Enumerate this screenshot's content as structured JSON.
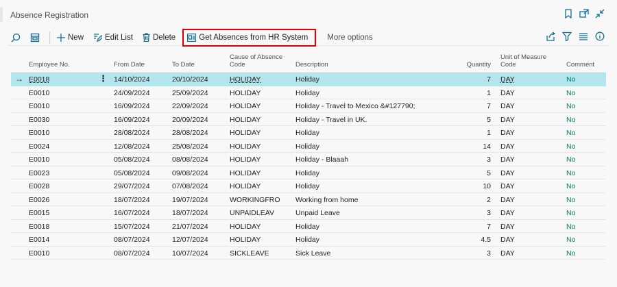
{
  "page": {
    "title": "Absence Registration"
  },
  "actions": {
    "new_label": "New",
    "edit_list_label": "Edit List",
    "delete_label": "Delete",
    "get_absences_label": "Get Absences from HR System",
    "more_options_label": "More options"
  },
  "columns": {
    "employee_no": "Employee No.",
    "from_date": "From Date",
    "to_date": "To Date",
    "cause_line1": "Cause of Absence",
    "cause_line2": "Code",
    "description": "Description",
    "quantity": "Quantity",
    "uom_line1": "Unit of Measure",
    "uom_line2": "Code",
    "comment": "Comment"
  },
  "rows": [
    {
      "emp": "E0018",
      "from": "14/10/2024",
      "to": "20/10/2024",
      "cause": "HOLIDAY",
      "desc": "Holiday",
      "qty": "7",
      "uom": "DAY",
      "comment": "No"
    },
    {
      "emp": "E0010",
      "from": "24/09/2024",
      "to": "25/09/2024",
      "cause": "HOLIDAY",
      "desc": "Holiday",
      "qty": "1",
      "uom": "DAY",
      "comment": "No"
    },
    {
      "emp": "E0010",
      "from": "16/09/2024",
      "to": "22/09/2024",
      "cause": "HOLIDAY",
      "desc": "Holiday - Travel to Mexico &#127790;",
      "qty": "7",
      "uom": "DAY",
      "comment": "No"
    },
    {
      "emp": "E0030",
      "from": "16/09/2024",
      "to": "20/09/2024",
      "cause": "HOLIDAY",
      "desc": "Holiday - Travel in UK.",
      "qty": "5",
      "uom": "DAY",
      "comment": "No"
    },
    {
      "emp": "E0010",
      "from": "28/08/2024",
      "to": "28/08/2024",
      "cause": "HOLIDAY",
      "desc": "Holiday",
      "qty": "1",
      "uom": "DAY",
      "comment": "No"
    },
    {
      "emp": "E0024",
      "from": "12/08/2024",
      "to": "25/08/2024",
      "cause": "HOLIDAY",
      "desc": "Holiday",
      "qty": "14",
      "uom": "DAY",
      "comment": "No"
    },
    {
      "emp": "E0010",
      "from": "05/08/2024",
      "to": "08/08/2024",
      "cause": "HOLIDAY",
      "desc": "Holiday - Blaaah",
      "qty": "3",
      "uom": "DAY",
      "comment": "No"
    },
    {
      "emp": "E0023",
      "from": "05/08/2024",
      "to": "09/08/2024",
      "cause": "HOLIDAY",
      "desc": "Holiday",
      "qty": "5",
      "uom": "DAY",
      "comment": "No"
    },
    {
      "emp": "E0028",
      "from": "29/07/2024",
      "to": "07/08/2024",
      "cause": "HOLIDAY",
      "desc": "Holiday",
      "qty": "10",
      "uom": "DAY",
      "comment": "No"
    },
    {
      "emp": "E0026",
      "from": "18/07/2024",
      "to": "19/07/2024",
      "cause": "WORKINGFRO",
      "desc": "Working from home",
      "qty": "2",
      "uom": "DAY",
      "comment": "No"
    },
    {
      "emp": "E0015",
      "from": "16/07/2024",
      "to": "18/07/2024",
      "cause": "UNPAIDLEAV",
      "desc": "Unpaid Leave",
      "qty": "3",
      "uom": "DAY",
      "comment": "No"
    },
    {
      "emp": "E0018",
      "from": "15/07/2024",
      "to": "21/07/2024",
      "cause": "HOLIDAY",
      "desc": "Holiday",
      "qty": "7",
      "uom": "DAY",
      "comment": "No"
    },
    {
      "emp": "E0014",
      "from": "08/07/2024",
      "to": "12/07/2024",
      "cause": "HOLIDAY",
      "desc": "Holiday",
      "qty": "4.5",
      "uom": "DAY",
      "comment": "No"
    },
    {
      "emp": "E0010",
      "from": "08/07/2024",
      "to": "10/07/2024",
      "cause": "SICKLEAVE",
      "desc": "Sick Leave",
      "qty": "3",
      "uom": "DAY",
      "comment": "No"
    }
  ],
  "selected_row_index": 0,
  "colors": {
    "accent": "#0f6c92",
    "selected_row": "#b2e5ec",
    "comment_text": "#00796b",
    "highlight_box": "#e00000"
  }
}
